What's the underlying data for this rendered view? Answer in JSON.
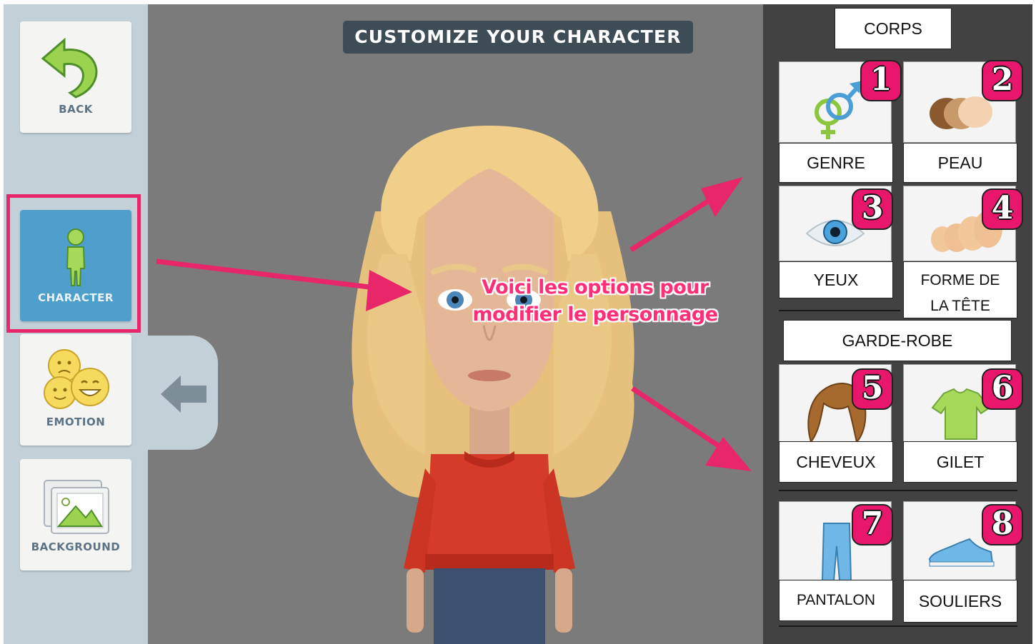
{
  "app": {
    "title": "CUSTOMIZE YOUR CHARACTER"
  },
  "sidebar": {
    "back_label": "BACK",
    "character_label": "CHARACTER",
    "emotion_label": "EMOTION",
    "background_label": "BACKGROUND"
  },
  "annotation": {
    "line1": "Voici les options pour",
    "line2": "modifier le personnage"
  },
  "panel": {
    "corps_label": "CORPS",
    "garde_robe_label": "GARDE-ROBE",
    "options": [
      {
        "number": "1",
        "label": "GENRE",
        "icon": "gender-icon"
      },
      {
        "number": "2",
        "label": "PEAU",
        "icon": "skin-tones-icon"
      },
      {
        "number": "3",
        "label": "YEUX",
        "icon": "eye-icon"
      },
      {
        "number": "4",
        "label_line1": "FORME DE",
        "label_line2": "LA TÊTE",
        "icon": "head-shape-icon"
      },
      {
        "number": "5",
        "label": "CHEVEUX",
        "icon": "hair-icon"
      },
      {
        "number": "6",
        "label": "GILET",
        "icon": "shirt-icon"
      },
      {
        "number": "7",
        "label": "PANTALON",
        "icon": "pants-icon"
      },
      {
        "number": "8",
        "label": "SOULIERS",
        "icon": "shoe-icon"
      }
    ]
  },
  "colors": {
    "accent": "#e8266a",
    "active_tab": "#4f9fcc",
    "title_bg": "#3e4c55"
  }
}
